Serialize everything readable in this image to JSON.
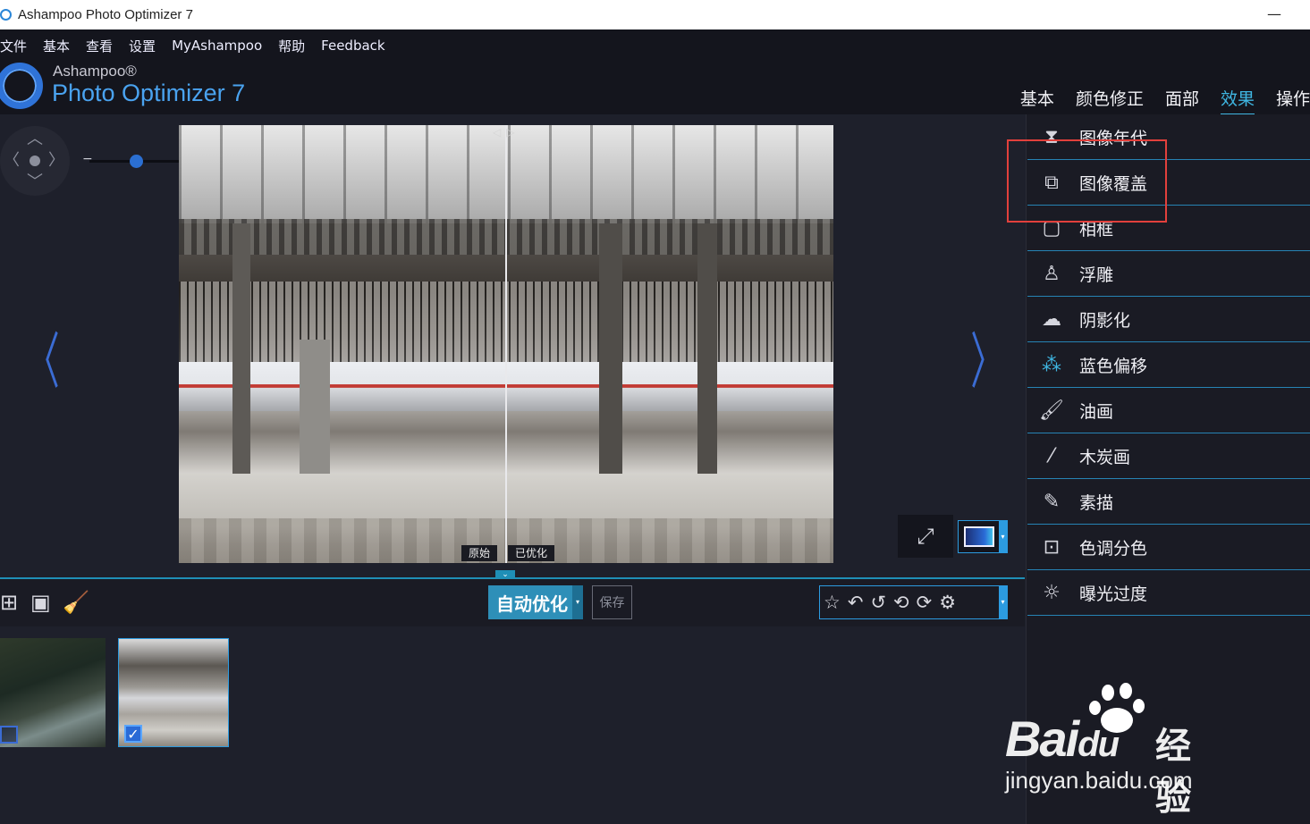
{
  "window": {
    "title": "Ashampoo Photo Optimizer 7",
    "minimize": "—"
  },
  "menu": [
    "文件",
    "基本",
    "查看",
    "设置",
    "MyAshampoo",
    "帮助",
    "Feedback"
  ],
  "logo": {
    "sub": "Ashampoo®",
    "main": "Photo Optimizer 7"
  },
  "tabs": [
    "基本",
    "颜色修正",
    "面部",
    "效果",
    "操作"
  ],
  "active_tab": "效果",
  "zoom": {
    "minus": "−",
    "plus": "+",
    "level": 0.38
  },
  "nav": {
    "prev": "〈",
    "next": "〉",
    "up": "︿",
    "down": "﹀",
    "left": "〈",
    "right": "〉"
  },
  "compare_labels": {
    "original": "原始",
    "optimized": "已优化"
  },
  "compare_handle": "◁▷",
  "toolbar": {
    "auto_optimize": "自动优化",
    "save": "保存",
    "dropdown": "▾",
    "collapse": "⌄"
  },
  "effects": [
    {
      "label": "图像年代",
      "icon": "hourglass-icon",
      "glyph": "⧗"
    },
    {
      "label": "图像覆盖",
      "icon": "image-overlay-icon",
      "glyph": "⧉"
    },
    {
      "label": "相框",
      "icon": "frame-icon",
      "glyph": "▢"
    },
    {
      "label": "浮雕",
      "icon": "emboss-icon",
      "glyph": "♙"
    },
    {
      "label": "阴影化",
      "icon": "shadow-cloud-icon",
      "glyph": "☁"
    },
    {
      "label": "蓝色偏移",
      "icon": "blue-shift-icon",
      "glyph": "⁂"
    },
    {
      "label": "油画",
      "icon": "brush-icon",
      "glyph": "🖌"
    },
    {
      "label": "木炭画",
      "icon": "charcoal-icon",
      "glyph": "⁄"
    },
    {
      "label": "素描",
      "icon": "pencil-icon",
      "glyph": "✎"
    },
    {
      "label": "色调分色",
      "icon": "posterize-icon",
      "glyph": "⊡"
    },
    {
      "label": "曝光过度",
      "icon": "sun-icon",
      "glyph": "☼"
    }
  ],
  "thumbnails": [
    {
      "checked": false
    },
    {
      "checked": true,
      "check": "✓"
    }
  ],
  "watermark": {
    "brand": "Bai",
    "brand2": "du",
    "cn": "经验",
    "url": "jingyan.baidu.com"
  },
  "colors": {
    "accent": "#2c9be0",
    "highlight": "#e2403c",
    "logo_blue": "#2f73d8"
  }
}
